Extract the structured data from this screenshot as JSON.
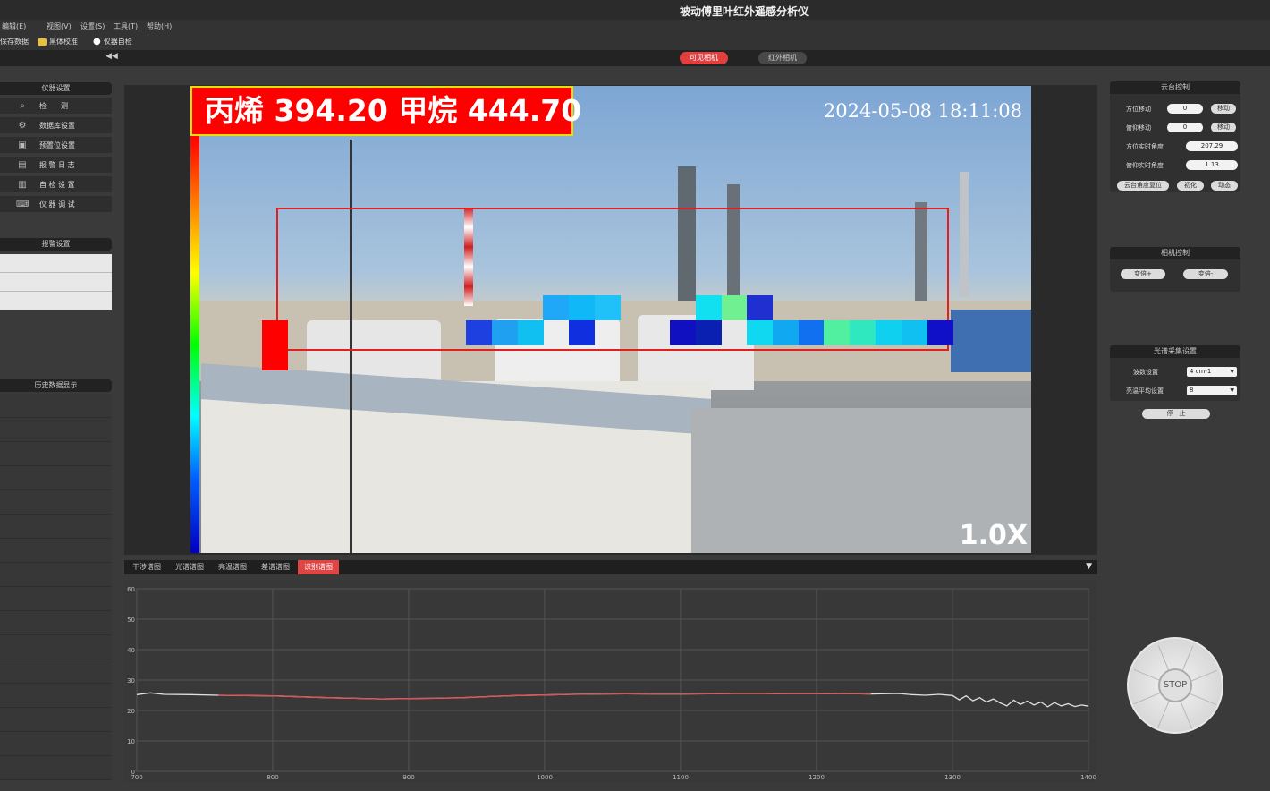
{
  "app": {
    "title": "被动傅里叶红外遥感分析仪"
  },
  "menu": [
    "编辑(E)",
    "视图(V)",
    "设置(S)",
    "工具(T)",
    "帮助(H)"
  ],
  "toolbar": {
    "save": "保存数据",
    "blackbody": "黑体校准",
    "selfcheck": "仪器自检"
  },
  "modes": {
    "visible": "可见相机",
    "ir": "红外相机"
  },
  "sidebar": {
    "instrument_title": "仪器设置",
    "items": [
      {
        "label": "检　　测",
        "icon": "search-doc-icon",
        "glyph": "⌕"
      },
      {
        "label": "数据库设置",
        "icon": "gear-icon",
        "glyph": "⚙"
      },
      {
        "label": "预置位设置",
        "icon": "monitor-icon",
        "glyph": "▣"
      },
      {
        "label": "报 警 日 志",
        "icon": "log-icon",
        "glyph": "▤"
      },
      {
        "label": "自 检 设 置",
        "icon": "bar-chart-icon",
        "glyph": "▥"
      },
      {
        "label": "仪 器 调 试",
        "icon": "laptop-icon",
        "glyph": "⌨"
      }
    ],
    "alarm_title": "报警设置",
    "history_title": "历史数据显示"
  },
  "camera": {
    "gas_reading": "丙烯 394.20 甲烷 444.70",
    "timestamp": "2024-05-08  18:11:08",
    "zoom": "1.0X"
  },
  "ptz": {
    "title": "云台控制",
    "azimuth_move_label": "方位移动",
    "azimuth_move_value": "0",
    "azimuth_move_btn": "移动",
    "pitch_move_label": "俯仰移动",
    "pitch_move_value": "0",
    "pitch_move_btn": "移动",
    "azimuth_angle_label": "方位实时角度",
    "azimuth_angle_value": "207.29",
    "pitch_angle_label": "俯仰实时角度",
    "pitch_angle_value": "1.13",
    "reset_btn": "云台角度复位",
    "init_btn": "初化",
    "dynamic_btn": "动态"
  },
  "camera_ctrl": {
    "title": "相机控制",
    "zoom_in": "变倍+",
    "zoom_out": "变倍-"
  },
  "spectrum_settings": {
    "title": "光谱采集设置",
    "wavenumber_label": "波数设置",
    "wavenumber_value": "4 cm-1",
    "avg_label": "亮温平均设置",
    "avg_value": "8",
    "stop_btn": "停　止"
  },
  "spectrum_tabs": [
    "干涉谱图",
    "光谱谱图",
    "亮温谱图",
    "差谱谱图",
    "识别谱图"
  ],
  "active_spectrum_tab": 4,
  "joystick": {
    "stop": "STOP"
  },
  "chart_data": {
    "type": "line",
    "xlim": [
      700,
      1400
    ],
    "ylim": [
      0,
      60
    ],
    "x_ticks": [
      700,
      800,
      900,
      1000,
      1100,
      1200,
      1300,
      1400
    ],
    "y_ticks": [
      0,
      10,
      20,
      30,
      40,
      50,
      60
    ],
    "grid": true,
    "series": [
      {
        "color": "#e0e0e0",
        "x": [
          700,
          710,
          720,
          740,
          760,
          780,
          800,
          820,
          840,
          860,
          880,
          900,
          920,
          940,
          960,
          980,
          1000,
          1020,
          1040,
          1060,
          1080,
          1100,
          1120,
          1140,
          1160,
          1180,
          1200,
          1220,
          1240,
          1260,
          1270,
          1280,
          1290,
          1300,
          1305,
          1310,
          1315,
          1320,
          1325,
          1330,
          1335,
          1340,
          1345,
          1350,
          1355,
          1360,
          1365,
          1370,
          1375,
          1380,
          1385,
          1390,
          1395,
          1400
        ],
        "y": [
          25.2,
          25.8,
          25.3,
          25.2,
          25.0,
          24.9,
          24.8,
          24.5,
          24.2,
          24.0,
          23.8,
          23.9,
          24.0,
          24.2,
          24.6,
          24.9,
          25.1,
          25.3,
          25.4,
          25.5,
          25.4,
          25.4,
          25.5,
          25.6,
          25.6,
          25.5,
          25.5,
          25.6,
          25.4,
          25.6,
          25.2,
          25.0,
          25.3,
          24.9,
          23.5,
          24.8,
          23.2,
          24.2,
          22.8,
          23.8,
          22.5,
          21.5,
          23.4,
          22.0,
          23.1,
          21.8,
          22.8,
          21.2,
          22.6,
          21.5,
          22.2,
          21.3,
          21.8,
          21.4
        ]
      }
    ],
    "highlight": {
      "color": "#e05050",
      "x_range": [
        760,
        1250
      ]
    }
  }
}
